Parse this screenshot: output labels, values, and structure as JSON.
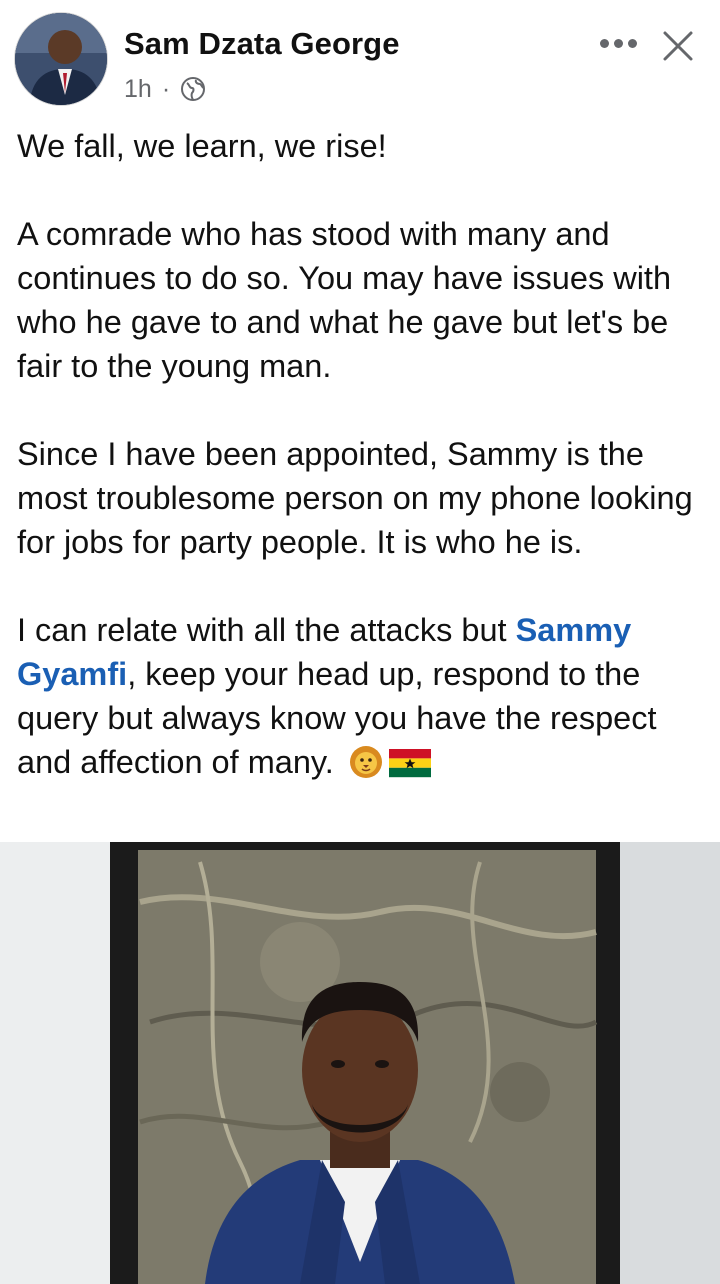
{
  "post": {
    "author": "Sam Dzata George",
    "time": "1h",
    "separator": "·",
    "privacy_icon": "globe-icon",
    "menu_icon": "more-icon",
    "close_icon": "close-icon",
    "paragraph_1": "We fall, we learn, we rise!",
    "paragraph_2": "A comrade who has stood with many and continues to do so. You may have issues with who he gave to and what he gave but let's be fair to the young man.",
    "paragraph_3": "Since I have been appointed, Sammy is the most troublesome person on my phone looking for jobs for party people. It is who he is.",
    "paragraph_4_before": "I can relate with all the attacks but ",
    "mention": "Sammy Gyamfi",
    "paragraph_4_after": ", keep your head up, respond to the query but always know you have the respect and affection of many.",
    "emojis": [
      "lion-face-emoji",
      "ghana-flag-emoji"
    ]
  },
  "colors": {
    "mention": "#1a5fb4",
    "meta_text": "#65676b",
    "text": "#111111"
  }
}
